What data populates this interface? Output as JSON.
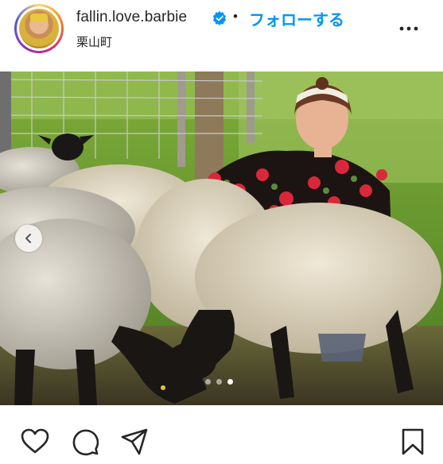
{
  "post": {
    "username": "fallin.love.barbie",
    "separator": "•",
    "follow_label": "フォローする",
    "location": "栗山町",
    "more_icon": "more-horizontal-icon",
    "verified_icon": "verified-badge-icon"
  },
  "carousel": {
    "current_index": 3,
    "total": 3
  },
  "actions": {
    "like_icon": "heart-icon",
    "comment_icon": "comment-icon",
    "share_icon": "send-icon",
    "save_icon": "bookmark-icon"
  },
  "colors": {
    "accent": "#0095f6",
    "text": "#262626"
  }
}
